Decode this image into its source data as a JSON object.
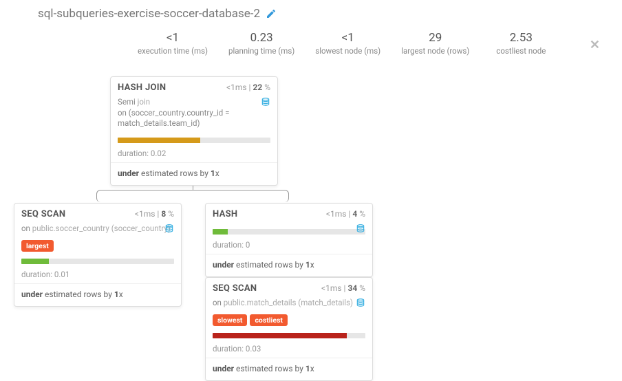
{
  "title": "sql-subqueries-exercise-soccer-database-2",
  "stats": {
    "exec_time": {
      "value": "<1",
      "label": "execution time (ms)"
    },
    "plan_time": {
      "value": "0.23",
      "label": "planning time (ms)"
    },
    "slowest_node": {
      "value": "<1",
      "label": "slowest node (ms)"
    },
    "largest_node": {
      "value": "29",
      "label": "largest node (rows)"
    },
    "costliest_node": {
      "value": "2.53",
      "label": "costliest node"
    }
  },
  "nodes": {
    "hash_join": {
      "title": "HASH JOIN",
      "time": "<1",
      "pct": "22",
      "desc_prefix": "Semi ",
      "desc_mid": "join",
      "desc_line2": "on (soccer_country.country_id = match_details.team_id)",
      "bar_color": "#d59a1a",
      "bar_pct": 54,
      "duration": "duration: 0.02",
      "estimate_word": "under",
      "estimate_mid": " estimated rows by ",
      "estimate_factor": "1",
      "estimate_suffix": "x"
    },
    "seq_scan_country": {
      "title": "SEQ SCAN",
      "time": "<1",
      "pct": "8",
      "desc_prefix": "on ",
      "desc_mid": "public.soccer_country (soccer_country)",
      "tag_largest": "largest",
      "bar_color": "#6fbb3a",
      "bar_pct": 18,
      "duration": "duration: 0.01",
      "estimate_word": "under",
      "estimate_mid": " estimated rows by ",
      "estimate_factor": "1",
      "estimate_suffix": "x"
    },
    "hash": {
      "title": "HASH",
      "time": "<1",
      "pct": "4",
      "bar_color": "#6fbb3a",
      "bar_pct": 10,
      "duration": "duration: 0",
      "estimate_word": "under",
      "estimate_mid": " estimated rows by ",
      "estimate_factor": "1",
      "estimate_suffix": "x"
    },
    "seq_scan_match": {
      "title": "SEQ SCAN",
      "time": "<1",
      "pct": "34",
      "desc_prefix": "on ",
      "desc_mid": "public.match_details (match_details)",
      "tag_slowest": "slowest",
      "tag_costliest": "costliest",
      "bar_color": "#b9231b",
      "bar_pct": 88,
      "duration": "duration: 0.03",
      "estimate_word": "under",
      "estimate_mid": " estimated rows by ",
      "estimate_factor": "1",
      "estimate_suffix": "x"
    }
  },
  "labels": {
    "ms_suffix": "ms",
    "pct_suffix": " %",
    "pipe": " | "
  }
}
